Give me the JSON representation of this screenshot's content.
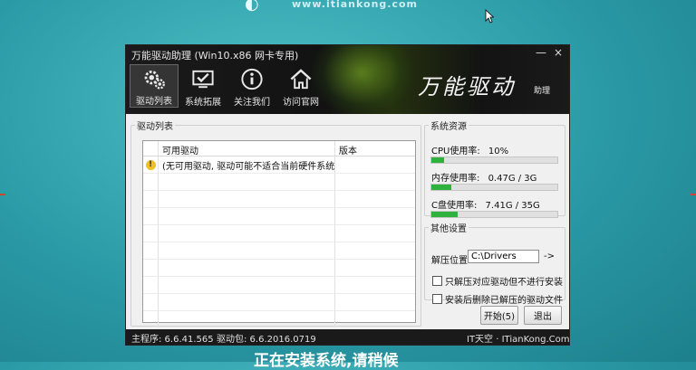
{
  "desktop": {
    "logo_text": "www.itiankong.com",
    "bottom_text": "正在安装系统,请稍候",
    "background_color": "#2a9aa6"
  },
  "window": {
    "title": "万能驱动助理 (Win10.x86 网卡专用)",
    "controls": {
      "minimize": "—",
      "close": "×"
    },
    "toolbar": [
      {
        "label": "驱动列表",
        "icon": "gears-icon",
        "active": true
      },
      {
        "label": "系统拓展",
        "icon": "monitor-check-icon",
        "active": false
      },
      {
        "label": "关注我们",
        "icon": "info-icon",
        "active": false
      },
      {
        "label": "访问官网",
        "icon": "home-icon",
        "active": false
      }
    ],
    "brand": "万能驱动",
    "brand_sub": "助理"
  },
  "driver_list": {
    "legend": "驱动列表",
    "columns": [
      "可用驱动",
      "版本"
    ],
    "rows": [
      {
        "name": "(无可用驱动, 驱动可能不适合当前硬件系统)",
        "version": "",
        "icon": "warning-icon"
      }
    ]
  },
  "system_resources": {
    "legend": "系统资源",
    "items": [
      {
        "label": "CPU使用率:",
        "value": "10%",
        "fill": 0.1
      },
      {
        "label": "内存使用率:",
        "value": "0.47G / 3G",
        "fill": 0.157
      },
      {
        "label": "C盘使用率:",
        "value": "7.41G / 35G",
        "fill": 0.212
      }
    ],
    "bar_color": "#2eb23d"
  },
  "other_settings": {
    "legend": "其他设置",
    "path_label": "解压位置",
    "path_value": "C:\\Drivers",
    "path_button": "->",
    "options": [
      {
        "label": "只解压对应驱动但不进行安装",
        "checked": false
      },
      {
        "label": "安装后删除已解压的驱动文件",
        "checked": false
      }
    ]
  },
  "buttons": {
    "start": "开始(5)",
    "exit": "退出"
  },
  "status_bar": {
    "main_version": "主程序: 6.6.41.565",
    "package_version": "驱动包: 6.6.2016.0719",
    "site": "IT天空 · ITianKong.Com"
  }
}
